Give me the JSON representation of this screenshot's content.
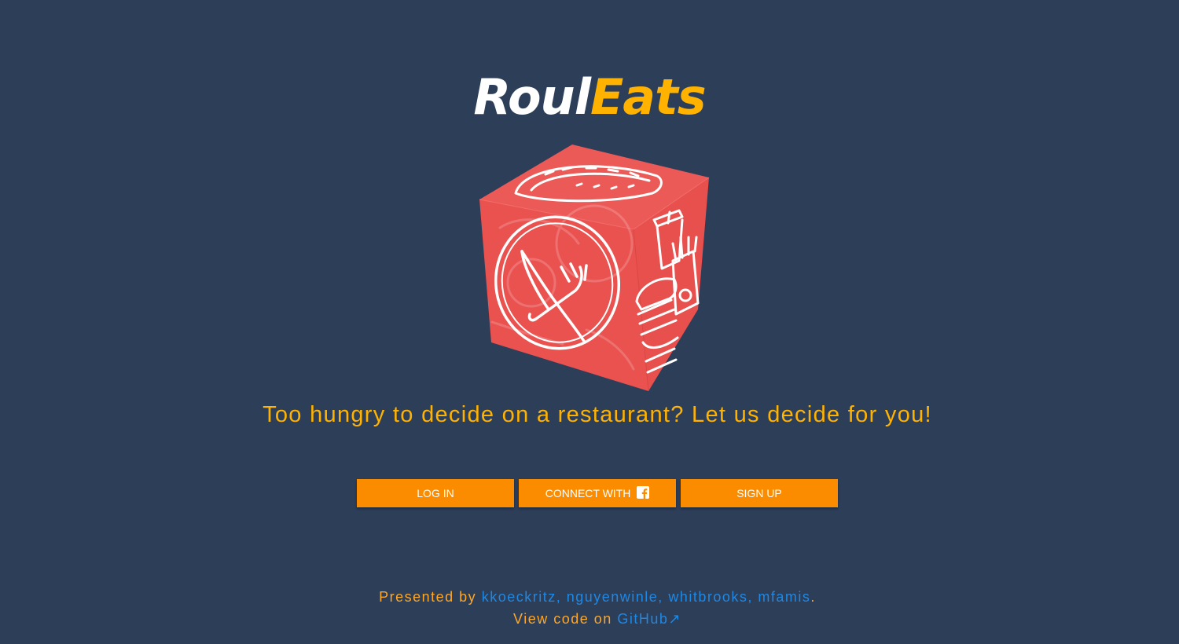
{
  "logo": {
    "part1": "Roul",
    "part2": "Eats"
  },
  "colors": {
    "background": "#2d3e59",
    "accent": "#ffb300",
    "button": "#fb8c00",
    "link": "#1e88e5",
    "cube": "#ef5350"
  },
  "hero": {
    "icon": "food-roulette-cube",
    "tagline": "Too hungry to decide on a restaurant? Let us decide for you!"
  },
  "buttons": {
    "login": "LOG IN",
    "connect": "CONNECT WITH",
    "connect_icon": "facebook-icon",
    "signup": "SIGN UP"
  },
  "footer": {
    "presented_by": "Presented by",
    "authors": [
      "kkoeckritz",
      "nguyenwinle",
      "whitbrooks",
      "mfamis"
    ],
    "sep": ", ",
    "period": ".",
    "view_code": "View code on",
    "github": "GitHub",
    "external_icon": "↗"
  }
}
